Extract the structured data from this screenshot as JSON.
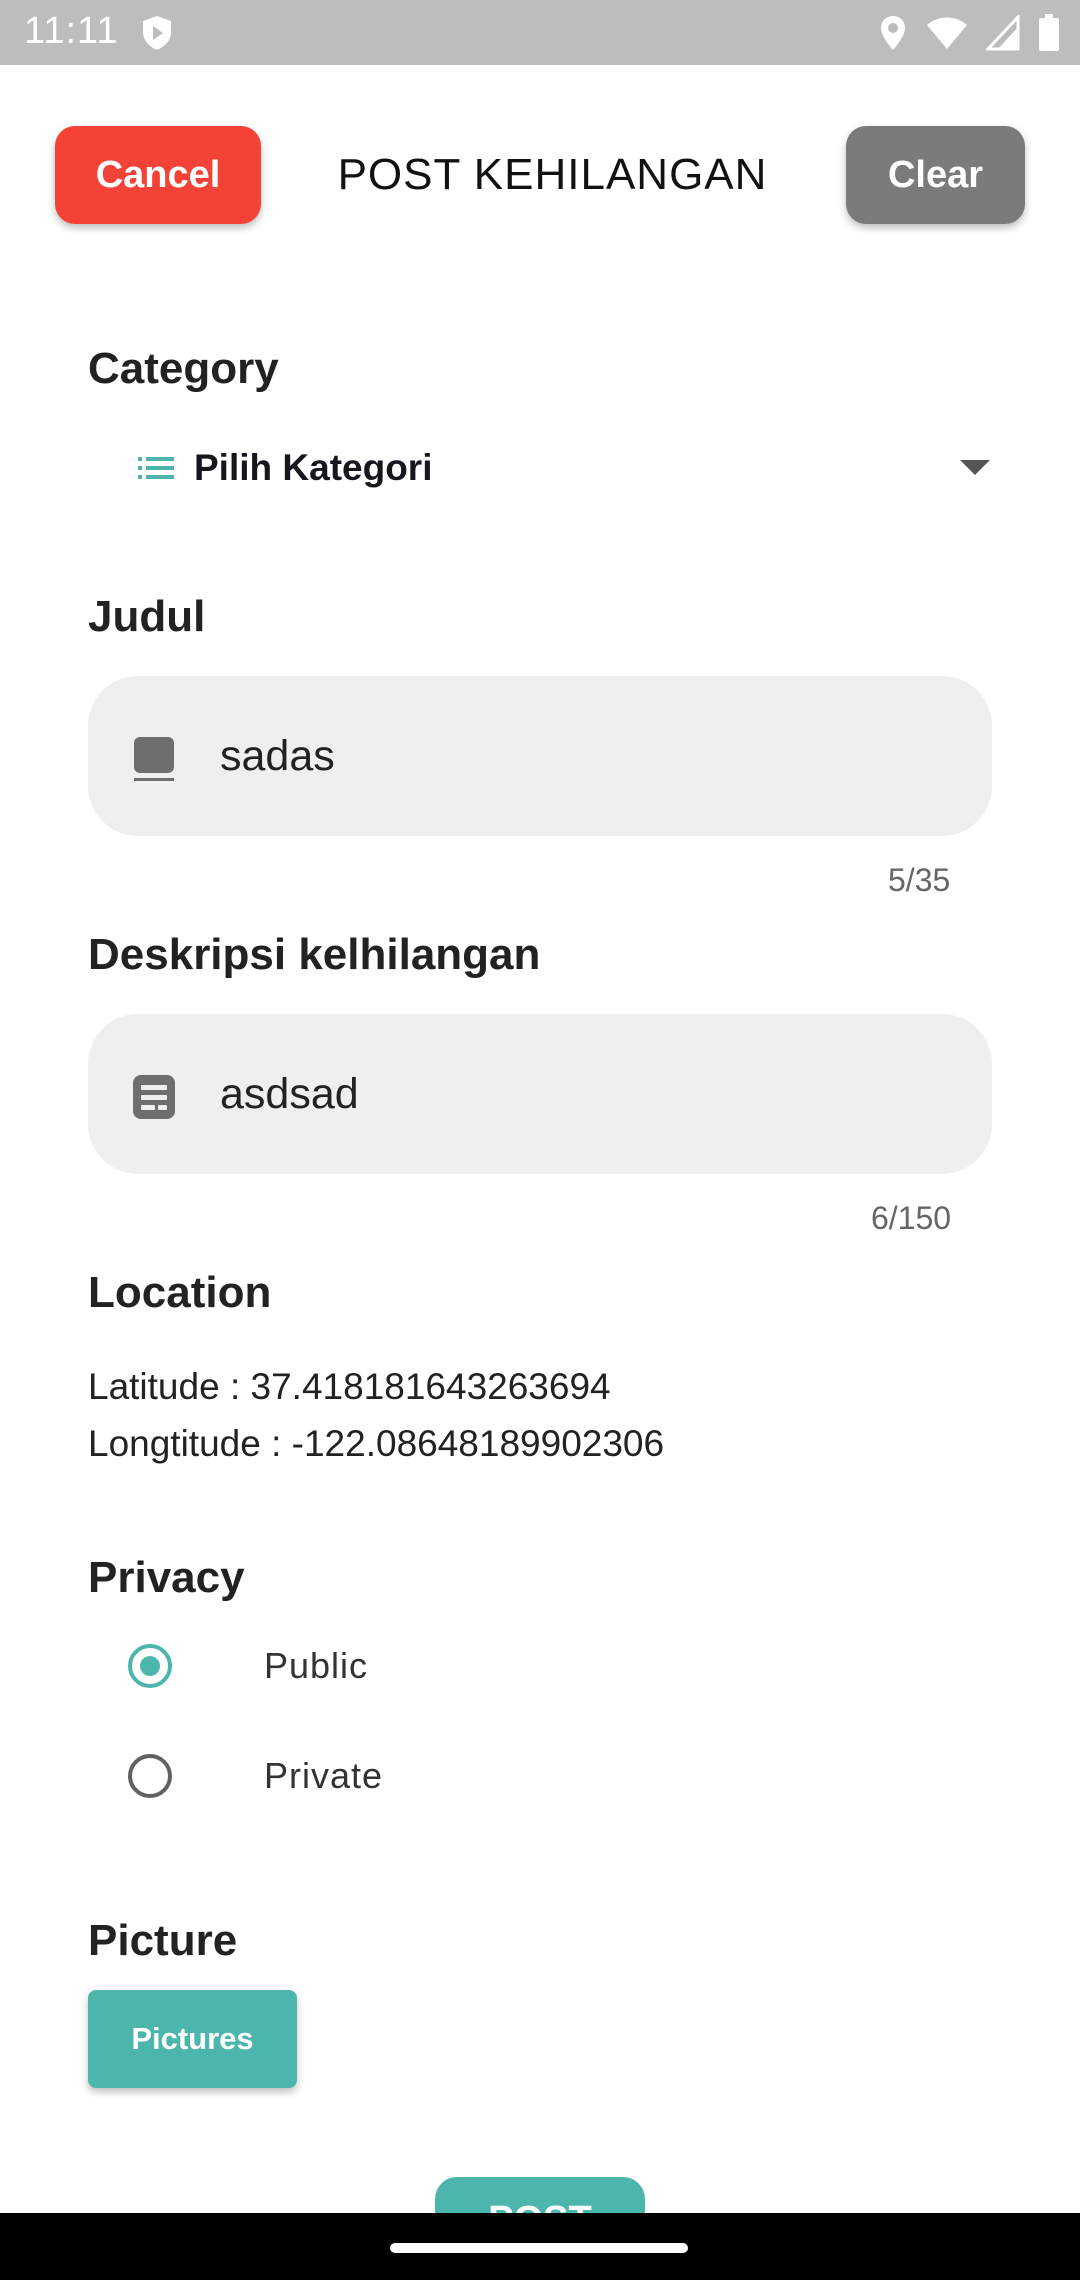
{
  "status_bar": {
    "time": "11:11",
    "icons": [
      "shield-play-icon",
      "location-pin-icon",
      "wifi-icon",
      "signal-icon",
      "battery-icon"
    ]
  },
  "header": {
    "cancel_label": "Cancel",
    "title": "POST KEHILANGAN",
    "clear_label": "Clear"
  },
  "category": {
    "label": "Category",
    "selected": "Pilih Kategori",
    "icon": "list-icon"
  },
  "judul": {
    "label": "Judul",
    "value": "sadas",
    "counter": "5/35",
    "icon": "title-icon"
  },
  "deskripsi": {
    "label": "Deskripsi kelhilangan",
    "value": "asdsad",
    "counter": "6/150",
    "icon": "description-icon"
  },
  "location": {
    "label": "Location",
    "latitude": "Latitude : 37.418181643263694",
    "longitude": "Longtitude : -122.08648189902306"
  },
  "privacy": {
    "label": "Privacy",
    "options": [
      {
        "label": "Public",
        "selected": true
      },
      {
        "label": "Private",
        "selected": false
      }
    ]
  },
  "picture": {
    "label": "Picture",
    "button_label": "Pictures"
  },
  "post": {
    "button_label": "POST"
  },
  "colors": {
    "cancel": "#f44336",
    "clear": "#7b7b7b",
    "accent": "#4db6ac",
    "input_bg": "#efefef"
  }
}
